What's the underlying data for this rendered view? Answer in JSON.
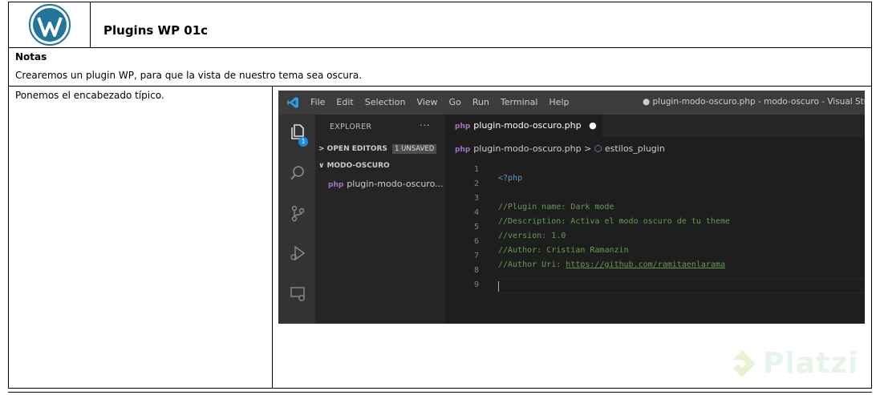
{
  "document": {
    "title": "Plugins WP 01c",
    "logo_icon": "wordpress-logo-icon",
    "notes_label": "Notas",
    "notes_text": "Crearemos un plugin WP, para que la vista de nuestro tema sea oscura.",
    "step_text": "Ponemos el encabezado típico."
  },
  "vscode": {
    "menu": [
      "File",
      "Edit",
      "Selection",
      "View",
      "Go",
      "Run",
      "Terminal",
      "Help"
    ],
    "window_title": "● plugin-modo-oscuro.php - modo-oscuro - Visual Stu",
    "activity_badge": "1",
    "sidebar": {
      "title": "EXPLORER",
      "more": "···",
      "open_editors": "> OPEN EDITORS",
      "unsaved_badge": "1 UNSAVED",
      "folder": "∨ MODO-OSCURO",
      "file": "plugin-modo-oscuro..."
    },
    "tab_label": "plugin-modo-oscuro.php",
    "tab_dirty_marker": "●",
    "breadcrumb_file": "plugin-modo-oscuro.php",
    "breadcrumb_separator": ">",
    "breadcrumb_symbol": "estilos_plugin",
    "php_glyph": "php",
    "code_lines": [
      {
        "num": "1",
        "text": "<?php"
      },
      {
        "num": "2",
        "text": ""
      },
      {
        "num": "3",
        "text": "//Plugin name: Dark mode"
      },
      {
        "num": "4",
        "text": "//Description: Activa el modo oscuro de tu theme"
      },
      {
        "num": "5",
        "text": "//version: 1.0"
      },
      {
        "num": "6",
        "text": "//Author: Cristian Ramanzin"
      },
      {
        "num": "7",
        "text_prefix": "//Author Uri: ",
        "link": "https://github.com/ramitaenlarama"
      },
      {
        "num": "8",
        "text": ""
      },
      {
        "num": "9",
        "text": ""
      }
    ]
  },
  "watermark": {
    "text": "Platzi",
    "icon": "platzi-logo-icon",
    "color": "#98CA3F"
  },
  "colors": {
    "editor_bg": "#1E1E1E",
    "titlebar_bg": "#3C3C3C",
    "sidebar_bg": "#252526",
    "comment": "#6A9955",
    "keyword": "#569CD6"
  }
}
